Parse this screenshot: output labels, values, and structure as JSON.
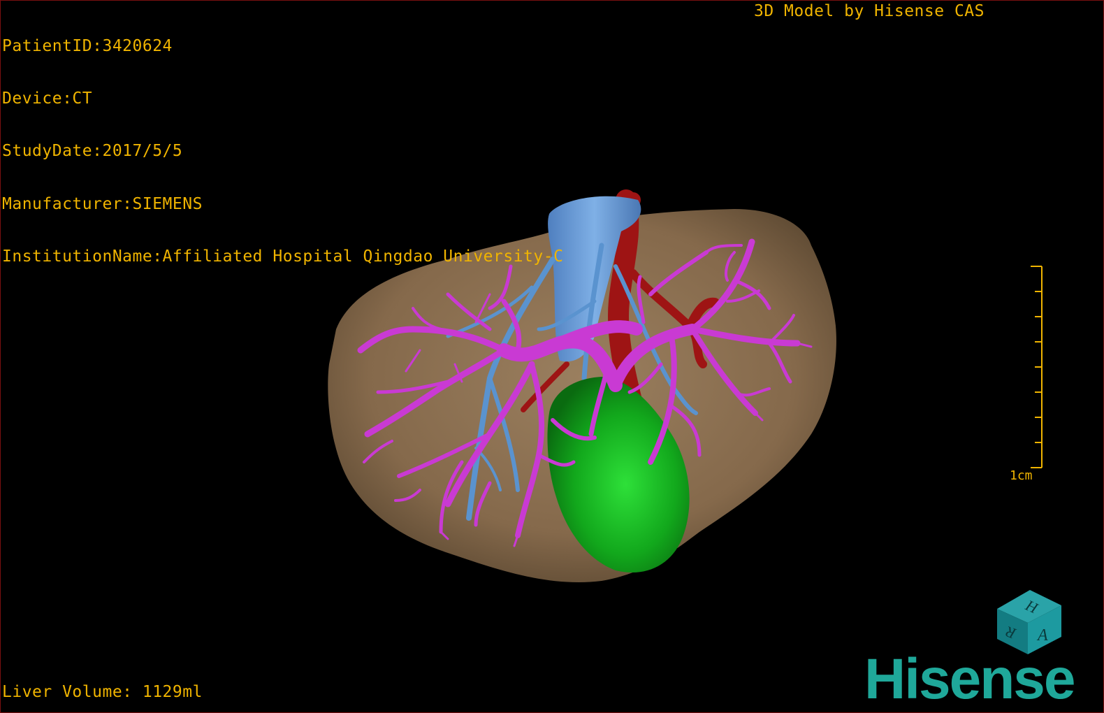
{
  "patient_info": {
    "patient_id": "PatientID:3420624",
    "device": "Device:CT",
    "study_date": "StudyDate:2017/5/5",
    "manufacturer": "Manufacturer:SIEMENS",
    "institution": "InstitutionName:Affiliated Hospital Qingdao University-C"
  },
  "model_credit": "3D Model by Hisense CAS",
  "liver_volume": "Liver Volume: 1129ml",
  "scale": {
    "label": "1cm",
    "tick_count": 9
  },
  "orientation_cube": {
    "faces": [
      "H",
      "R",
      "A"
    ]
  },
  "brand": "Hisense",
  "colors": {
    "overlay_text": "#f0b400",
    "liver": "#8b7153",
    "portal_vein": "#c93ad3",
    "hepatic_vein": "#5a93cf",
    "ivc": "#6a9bd6",
    "artery": "#9e1414",
    "gallbladder": "#13a81d",
    "brand": "#1fa89a"
  },
  "structures": [
    "liver",
    "portal-vein",
    "hepatic-vein",
    "inferior-vena-cava",
    "hepatic-artery",
    "gallbladder"
  ]
}
